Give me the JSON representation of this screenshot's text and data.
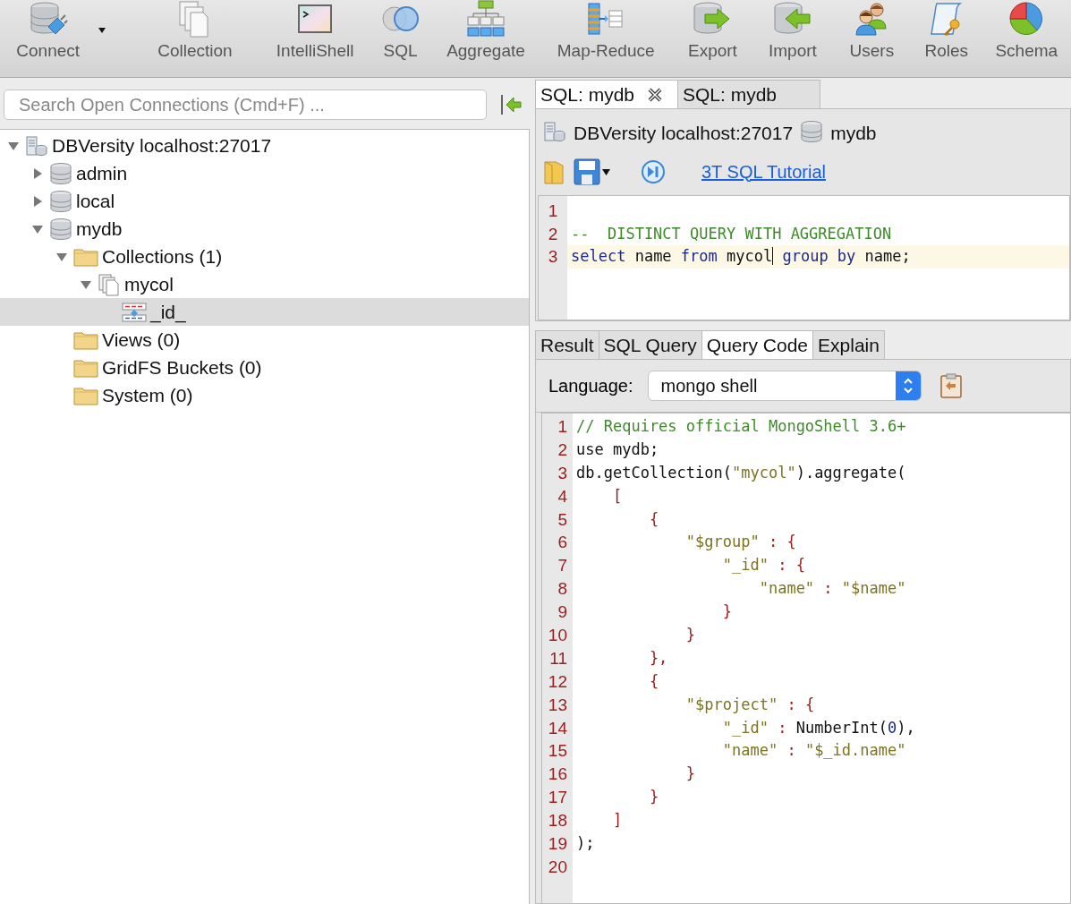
{
  "toolbar": [
    {
      "label": "Connect",
      "dropdown": true
    },
    {
      "label": "Collection",
      "dropdown": false
    },
    {
      "label": "IntelliShell",
      "dropdown": false
    },
    {
      "label": "SQL",
      "dropdown": false
    },
    {
      "label": "Aggregate",
      "dropdown": false
    },
    {
      "label": "Map-Reduce",
      "dropdown": false
    },
    {
      "label": "Export",
      "dropdown": false
    },
    {
      "label": "Import",
      "dropdown": false
    },
    {
      "label": "Users",
      "dropdown": false
    },
    {
      "label": "Roles",
      "dropdown": false
    },
    {
      "label": "Schema",
      "dropdown": false
    }
  ],
  "search": {
    "placeholder": "Search Open Connections (Cmd+F) ..."
  },
  "tree": [
    {
      "label": "DBVersity localhost:27017",
      "kind": "server",
      "expanded": true,
      "selected": false,
      "children": [
        {
          "label": "admin",
          "kind": "database",
          "expanded": false,
          "selected": false
        },
        {
          "label": "local",
          "kind": "database",
          "expanded": false,
          "selected": false
        },
        {
          "label": "mydb",
          "kind": "database",
          "expanded": true,
          "selected": false,
          "children": [
            {
              "label": "Collections (1)",
              "kind": "folder",
              "expanded": true,
              "selected": false,
              "children": [
                {
                  "label": "mycol",
                  "kind": "collection",
                  "expanded": true,
                  "selected": false,
                  "children": [
                    {
                      "label": "_id_",
                      "kind": "index",
                      "selected": true
                    }
                  ]
                }
              ]
            },
            {
              "label": "Views (0)",
              "kind": "folder",
              "selected": false
            },
            {
              "label": "GridFS Buckets (0)",
              "kind": "folder",
              "selected": false
            },
            {
              "label": "System (0)",
              "kind": "folder",
              "selected": false
            }
          ]
        }
      ]
    }
  ],
  "editor_tabs": [
    {
      "label": "SQL: mydb",
      "selected": true,
      "closable": true
    },
    {
      "label": "SQL: mydb",
      "selected": false,
      "closable": false
    }
  ],
  "connection": {
    "server": "DBVersity localhost:27017",
    "database": "mydb"
  },
  "tutorial_link": "3T SQL Tutorial",
  "sql_lines": [
    {
      "n": "1"
    },
    {
      "n": "2",
      "tokens": [
        {
          "t": "--  DISTINCT QUERY WITH AGGREGATION",
          "kind": "comment"
        }
      ]
    },
    {
      "n": "3",
      "current": true,
      "tokens": [
        {
          "t": "select",
          "kind": "keyword"
        },
        {
          "t": " name ",
          "kind": "plain"
        },
        {
          "t": "from",
          "kind": "keyword"
        },
        {
          "t": " mycol",
          "kind": "plain"
        },
        {
          "kind": "caret"
        },
        {
          "t": " group by",
          "kind": "keyword"
        },
        {
          "t": " name;",
          "kind": "plain"
        }
      ]
    }
  ],
  "result_tabs": [
    {
      "label": "Result",
      "selected": false
    },
    {
      "label": "SQL Query",
      "selected": false
    },
    {
      "label": "Query Code",
      "selected": true
    },
    {
      "label": "Explain",
      "selected": false
    }
  ],
  "language": {
    "label": "Language:",
    "value": "mongo shell"
  },
  "code_lines": [
    {
      "n": "1",
      "tokens": [
        {
          "t": "// Requires official MongoShell 3.6+",
          "kind": "comment"
        }
      ]
    },
    {
      "n": "2",
      "tokens": [
        {
          "t": "use mydb;",
          "kind": "plain"
        }
      ]
    },
    {
      "n": "3",
      "tokens": [
        {
          "t": "db.getCollection(",
          "kind": "plain"
        },
        {
          "t": "\"mycol\"",
          "kind": "string"
        },
        {
          "t": ").aggregate(",
          "kind": "plain"
        }
      ]
    },
    {
      "n": "4",
      "tokens": [
        {
          "t": "    [",
          "kind": "punct"
        }
      ]
    },
    {
      "n": "5",
      "tokens": [
        {
          "t": "        {",
          "kind": "punct"
        }
      ]
    },
    {
      "n": "6",
      "tokens": [
        {
          "t": "            \"$group\"",
          "kind": "string"
        },
        {
          "t": " : {",
          "kind": "punct"
        }
      ]
    },
    {
      "n": "7",
      "tokens": [
        {
          "t": "                \"_id\"",
          "kind": "string"
        },
        {
          "t": " : {",
          "kind": "punct"
        }
      ]
    },
    {
      "n": "8",
      "tokens": [
        {
          "t": "                    \"name\"",
          "kind": "string"
        },
        {
          "t": " : ",
          "kind": "punct"
        },
        {
          "t": "\"$name\"",
          "kind": "string"
        }
      ]
    },
    {
      "n": "9",
      "tokens": [
        {
          "t": "                }",
          "kind": "punct"
        }
      ]
    },
    {
      "n": "10",
      "tokens": [
        {
          "t": "            }",
          "kind": "punct"
        }
      ]
    },
    {
      "n": "11",
      "tokens": [
        {
          "t": "        },",
          "kind": "punct"
        }
      ]
    },
    {
      "n": "12",
      "tokens": [
        {
          "t": "        {",
          "kind": "punct"
        }
      ]
    },
    {
      "n": "13",
      "tokens": [
        {
          "t": "            \"$project\"",
          "kind": "string"
        },
        {
          "t": " : {",
          "kind": "punct"
        }
      ]
    },
    {
      "n": "14",
      "tokens": [
        {
          "t": "                \"_id\"",
          "kind": "string"
        },
        {
          "t": " : ",
          "kind": "punct"
        },
        {
          "t": "NumberInt(",
          "kind": "plain"
        },
        {
          "t": "0",
          "kind": "number"
        },
        {
          "t": "),",
          "kind": "plain"
        }
      ]
    },
    {
      "n": "15",
      "tokens": [
        {
          "t": "                \"name\"",
          "kind": "string"
        },
        {
          "t": " : ",
          "kind": "punct"
        },
        {
          "t": "\"$_id.name\"",
          "kind": "string"
        }
      ]
    },
    {
      "n": "16",
      "tokens": [
        {
          "t": "            }",
          "kind": "punct"
        }
      ]
    },
    {
      "n": "17",
      "tokens": [
        {
          "t": "        }",
          "kind": "punct"
        }
      ]
    },
    {
      "n": "18",
      "tokens": [
        {
          "t": "    ]",
          "kind": "punct"
        }
      ]
    },
    {
      "n": "19",
      "tokens": [
        {
          "t": ");",
          "kind": "plain"
        }
      ]
    },
    {
      "n": "20"
    }
  ]
}
